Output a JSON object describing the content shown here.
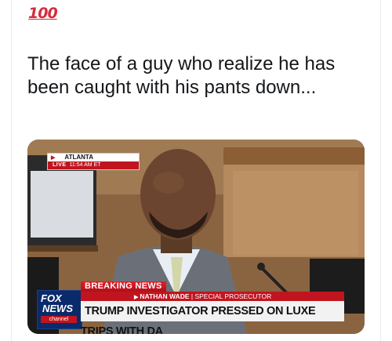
{
  "tweet": {
    "emoji": "100",
    "text": "The face of a guy who realize he has been caught with his pants down..."
  },
  "media": {
    "location_banner": {
      "city": "ATLANTA",
      "live_label": "LIVE",
      "time": "11:54 AM ET"
    },
    "breaking_label": "BREAKING NEWS",
    "subline_name": "NATHAN WADE",
    "subline_role": "| SPECIAL PROSECUTOR",
    "headline": "TRUMP INVESTIGATOR PRESSED ON LUXE TRIPS WITH DA",
    "logo": {
      "line1": "FOX",
      "line2": "NEWS",
      "line3": "channel"
    }
  }
}
